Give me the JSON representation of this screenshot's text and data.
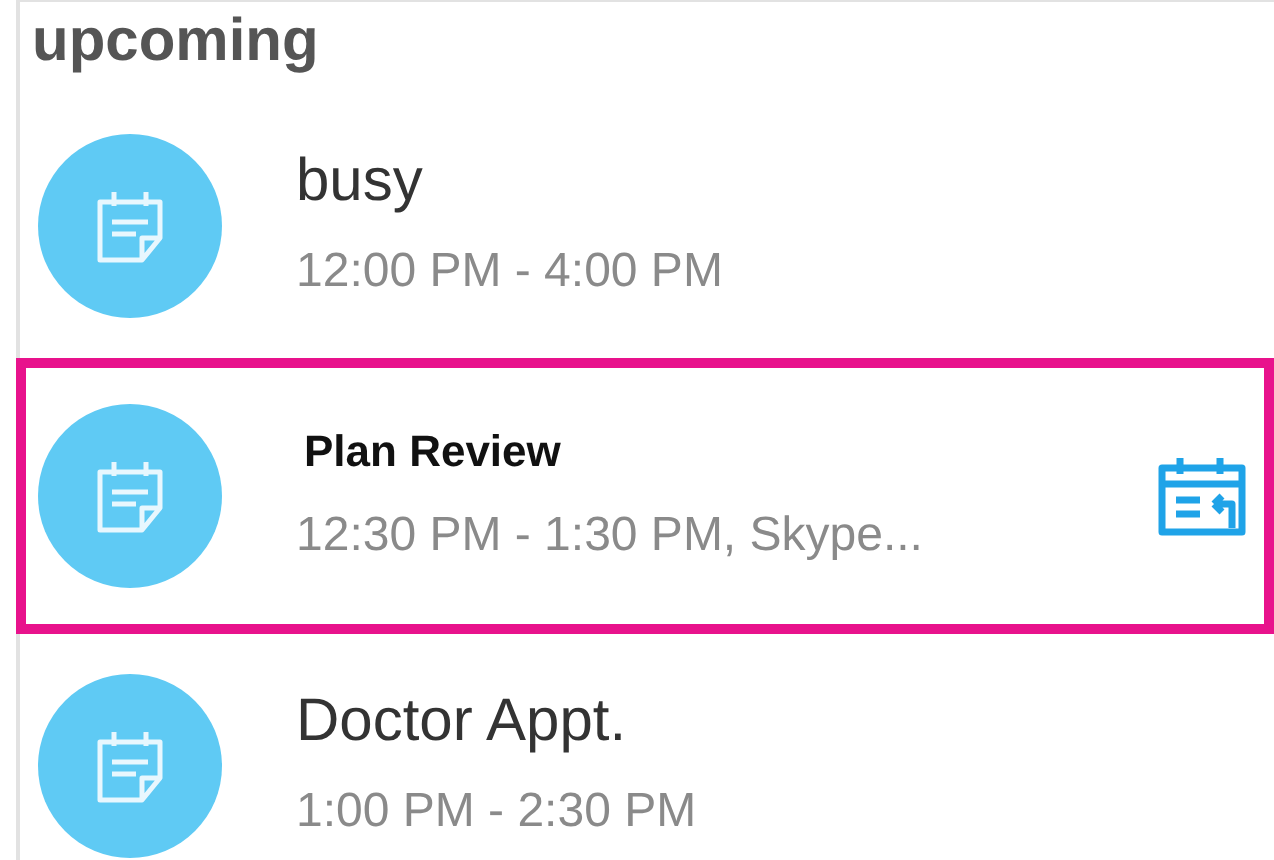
{
  "header": {
    "title": "upcoming"
  },
  "events": [
    {
      "title": "busy",
      "time": "12:00 PM - 4:00 PM",
      "selected": false
    },
    {
      "title": "Plan Review",
      "time": "12:30 PM - 1:30 PM, Skype...",
      "selected": true
    },
    {
      "title": "Doctor Appt.",
      "time": "1:00 PM - 2:30 PM",
      "selected": false
    }
  ]
}
